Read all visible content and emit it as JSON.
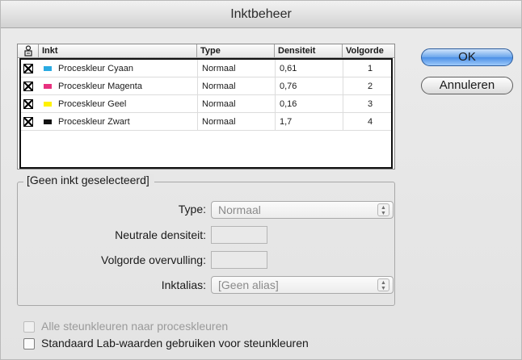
{
  "window": {
    "title": "Inktbeheer"
  },
  "table": {
    "headers": {
      "visibility_icon": "visibility-icon",
      "ink": "Inkt",
      "type": "Type",
      "density": "Densiteit",
      "order": "Volgorde"
    },
    "rows": [
      {
        "name": "Proceskleur Cyaan",
        "swatch": "#2aaae2",
        "type": "Normaal",
        "density": "0,61",
        "order": "1"
      },
      {
        "name": "Proceskleur Magenta",
        "swatch": "#e8317f",
        "type": "Normaal",
        "density": "0,76",
        "order": "2"
      },
      {
        "name": "Proceskleur Geel",
        "swatch": "#fff200",
        "type": "Normaal",
        "density": "0,16",
        "order": "3"
      },
      {
        "name": "Proceskleur Zwart",
        "swatch": "#111111",
        "type": "Normaal",
        "density": "1,7",
        "order": "4"
      }
    ]
  },
  "buttons": {
    "ok": "OK",
    "cancel": "Annuleren"
  },
  "group": {
    "title": "[Geen inkt geselecteerd]",
    "type_label": "Type:",
    "type_value": "Normaal",
    "neutral_density_label": "Neutrale densiteit:",
    "trap_order_label": "Volgorde overvulling:",
    "alias_label": "Inktalias:",
    "alias_value": "[Geen alias]"
  },
  "checkboxes": {
    "all_spot_to_process": "Alle steunkleuren naar proceskleuren",
    "standard_lab": "Standaard Lab-waarden gebruiken voor steunkleuren"
  },
  "colors": {
    "accent": "#4b8fe6"
  }
}
